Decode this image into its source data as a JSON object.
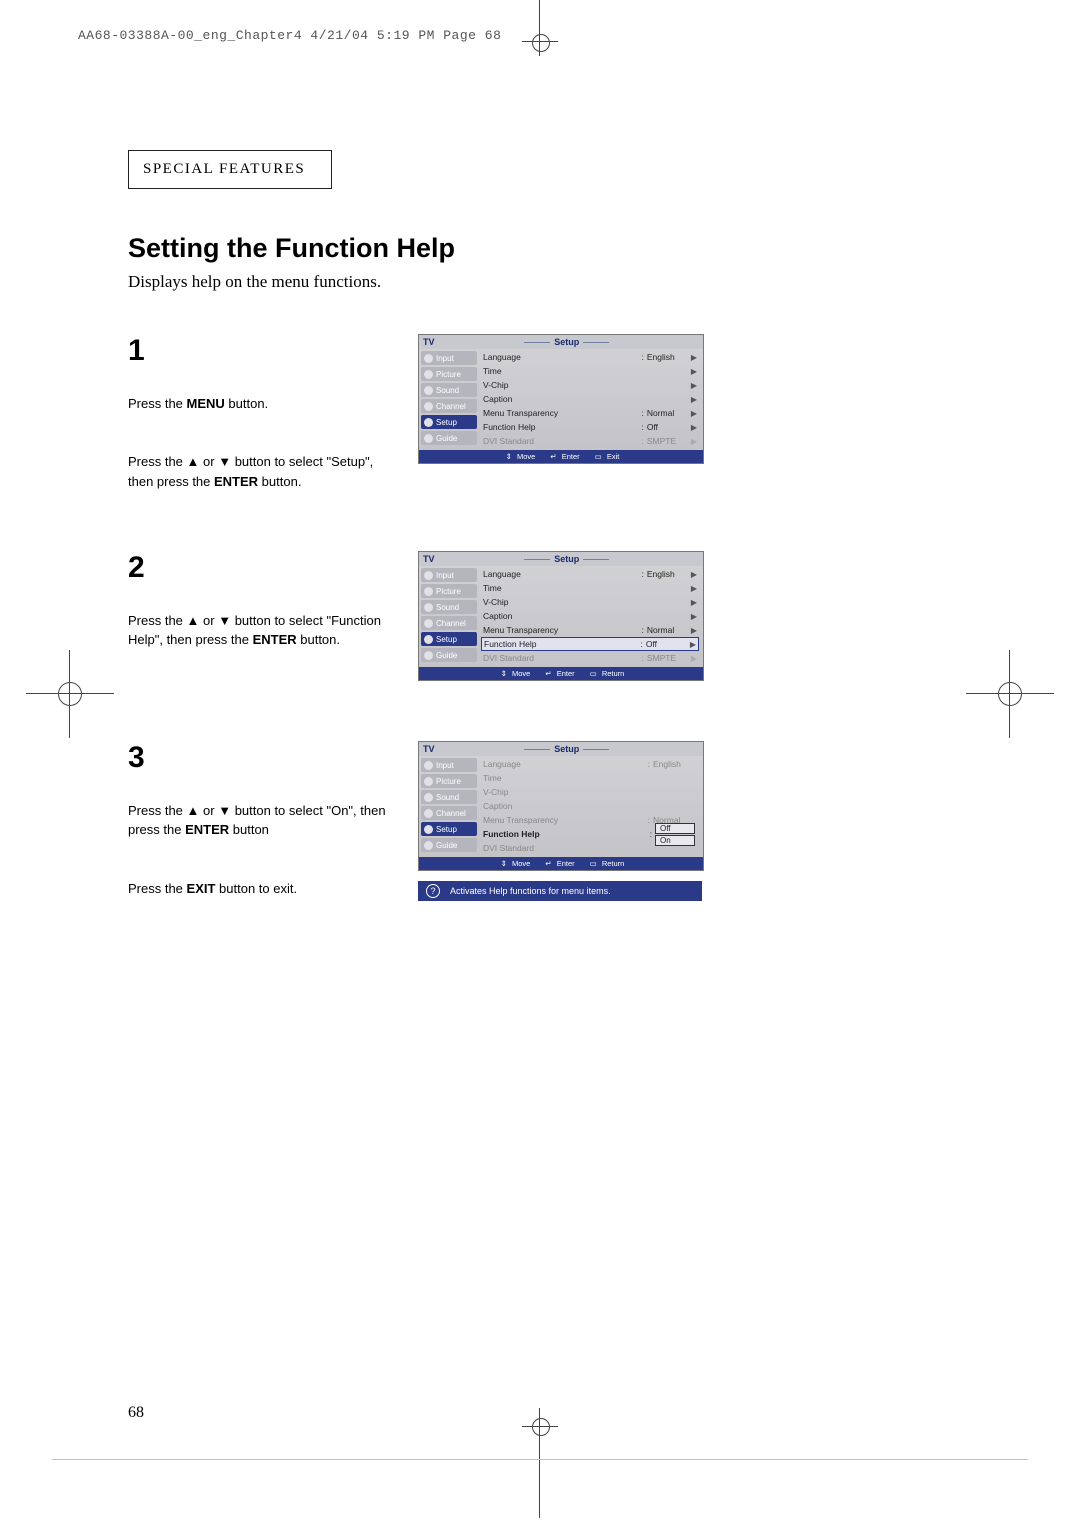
{
  "header": "AA68-03388A-00_eng_Chapter4  4/21/04  5:19 PM  Page 68",
  "section_label": "SPECIAL FEATURES",
  "heading": "Setting the Function Help",
  "subtitle": "Displays help on the menu functions.",
  "page_number": "68",
  "steps": {
    "s1": {
      "num": "1",
      "para1_a": "Press the ",
      "para1_b": "MENU",
      "para1_c": " button.",
      "para2_a": "Press the ",
      "para2_b": " or ",
      "para2_c": " button to select \"Setup\", then press the ",
      "para2_d": "ENTER",
      "para2_e": " button."
    },
    "s2": {
      "num": "2",
      "para_a": "Press the ",
      "para_b": " or ",
      "para_c": " button to select \"Function Help\", then press the ",
      "para_d": "ENTER",
      "para_e": " button."
    },
    "s3": {
      "num": "3",
      "para1_a": "Press the ",
      "para1_b": " or ",
      "para1_c": " button to select \"On\", then press the ",
      "para1_d": "ENTER",
      "para1_e": " button",
      "para2_a": "Press the ",
      "para2_b": "EXIT",
      "para2_c": " button to exit."
    }
  },
  "osd": {
    "tv": "TV",
    "title": "Setup",
    "side": [
      "Input",
      "Picture",
      "Sound",
      "Channel",
      "Setup",
      "Guide"
    ],
    "rows": [
      {
        "label": "Language",
        "val": "English"
      },
      {
        "label": "Time",
        "val": ""
      },
      {
        "label": "V-Chip",
        "val": ""
      },
      {
        "label": "Caption",
        "val": ""
      },
      {
        "label": "Menu Transparency",
        "val": "Normal"
      },
      {
        "label": "Function Help",
        "val": "Off"
      },
      {
        "label": "DVI Standard",
        "val": "SMPTE"
      }
    ],
    "foot_move": "Move",
    "foot_enter": "Enter",
    "foot_exit": "Exit",
    "foot_return": "Return"
  },
  "osd3_dropdown": {
    "opt1": "Off",
    "opt2": "On"
  },
  "help_bar": "Activates Help functions for menu items."
}
